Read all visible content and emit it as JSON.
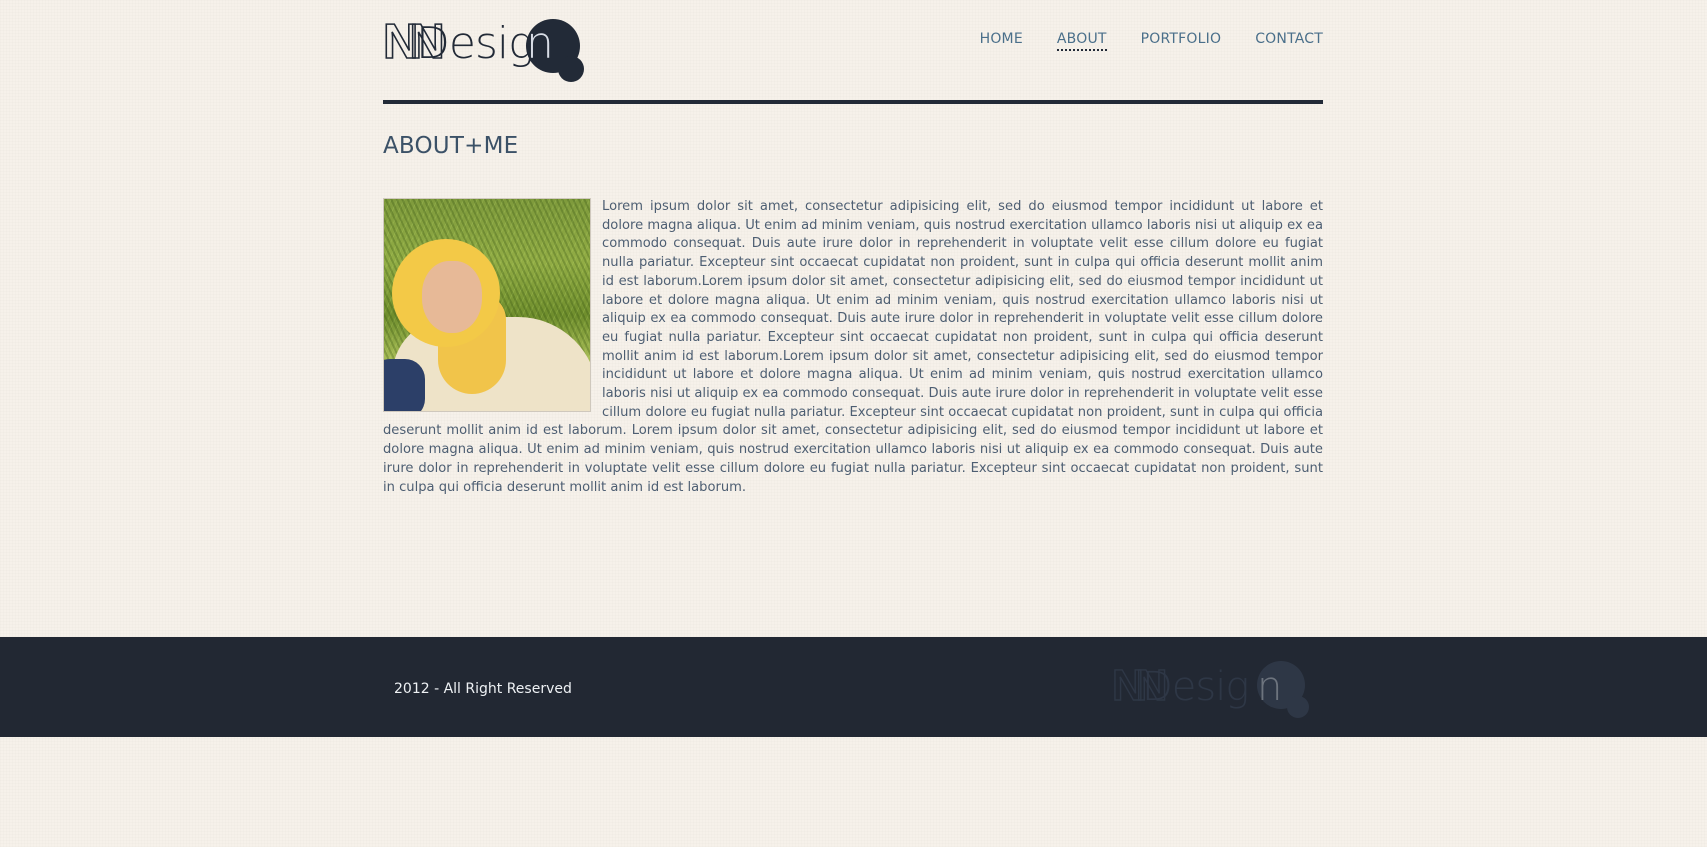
{
  "brand": {
    "logo_text_prefix": "NN",
    "logo_text_word": "Desig",
    "logo_text_last": "n"
  },
  "nav": {
    "items": [
      {
        "label": "HOME"
      },
      {
        "label": "ABOUT"
      },
      {
        "label": "PORTFOLIO"
      },
      {
        "label": "CONTACT"
      }
    ],
    "active": "ABOUT"
  },
  "main": {
    "title": "ABOUT+ME",
    "body": "Lorem ipsum dolor sit amet, consectetur adipisicing elit, sed do eiusmod tempor incididunt ut labore et dolore magna aliqua. Ut enim ad minim veniam, quis nostrud exercitation ullamco laboris nisi ut aliquip ex ea commodo consequat. Duis aute irure dolor in reprehenderit in voluptate velit esse cillum dolore eu fugiat nulla pariatur. Excepteur sint occaecat cupidatat non proident, sunt in culpa qui officia deserunt mollit anim id est laborum.Lorem ipsum dolor sit amet, consectetur adipisicing elit, sed do eiusmod tempor incididunt ut labore et dolore magna aliqua. Ut enim ad minim veniam, quis nostrud exercitation ullamco laboris nisi ut aliquip ex ea commodo consequat. Duis aute irure dolor in reprehenderit in voluptate velit esse cillum dolore eu fugiat nulla pariatur. Excepteur sint occaecat cupidatat non proident, sunt in culpa qui officia deserunt mollit anim id est laborum.Lorem ipsum dolor sit amet, consectetur adipisicing elit, sed do eiusmod tempor incididunt ut labore et dolore magna aliqua. Ut enim ad minim veniam, quis nostrud exercitation ullamco laboris nisi ut aliquip ex ea commodo consequat. Duis aute irure dolor in reprehenderit in voluptate velit esse cillum dolore eu fugiat nulla pariatur. Excepteur sint occaecat cupidatat non proident, sunt in culpa qui officia deserunt mollit anim id est laborum. Lorem ipsum dolor sit amet, consectetur adipisicing elit, sed do eiusmod tempor incididunt ut labore et dolore magna aliqua. Ut enim ad minim veniam, quis nostrud exercitation ullamco laboris nisi ut aliquip ex ea commodo consequat. Duis aute irure dolor in reprehenderit in voluptate velit esse cillum dolore eu fugiat nulla pariatur. Excepteur sint occaecat cupidatat non proident, sunt in culpa qui officia deserunt mollit anim id est laborum."
  },
  "footer": {
    "copyright": "2012 - All Right Reserved"
  },
  "colors": {
    "primary": "#222a37",
    "nav_link": "#4a6f8a",
    "text": "#4d5e72",
    "background": "#f6f1ea",
    "footer": "#222833"
  }
}
